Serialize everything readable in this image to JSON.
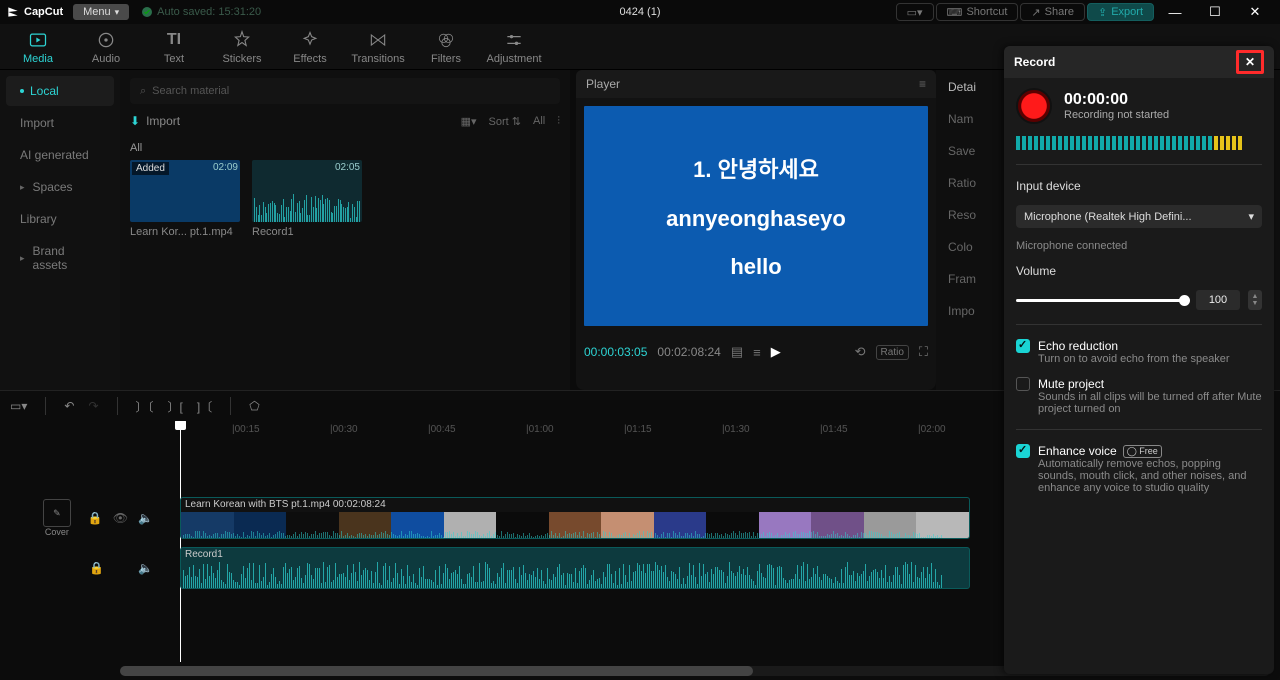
{
  "titlebar": {
    "brand": "CapCut",
    "menu_label": "Menu",
    "autosave": "Auto saved: 15:31:20",
    "project": "0424 (1)",
    "shortcut": "Shortcut",
    "share": "Share",
    "export": "Export"
  },
  "toptabs": [
    {
      "label": "Media",
      "icon": "media"
    },
    {
      "label": "Audio",
      "icon": "audio"
    },
    {
      "label": "Text",
      "icon": "text"
    },
    {
      "label": "Stickers",
      "icon": "stickers"
    },
    {
      "label": "Effects",
      "icon": "effects"
    },
    {
      "label": "Transitions",
      "icon": "transitions"
    },
    {
      "label": "Filters",
      "icon": "filters"
    },
    {
      "label": "Adjustment",
      "icon": "adjust"
    }
  ],
  "sidebar": {
    "items": [
      {
        "label": "Local",
        "active": true,
        "dot": true
      },
      {
        "label": "Import"
      },
      {
        "label": "AI generated"
      },
      {
        "label": "Spaces",
        "chev": true
      },
      {
        "label": "Library"
      },
      {
        "label": "Brand assets",
        "chev": true
      }
    ]
  },
  "media": {
    "search_placeholder": "Search material",
    "import_label": "Import",
    "sort_label": "Sort",
    "all_btn": "All",
    "all_label": "All",
    "clips": [
      {
        "name": "Learn Kor... pt.1.mp4",
        "dur": "02:09",
        "tag": "Added",
        "kind": "video"
      },
      {
        "name": "Record1",
        "dur": "02:05",
        "kind": "audio"
      }
    ]
  },
  "player": {
    "title": "Player",
    "line1": "1. 안녕하세요",
    "line2": "annyeonghaseyo",
    "line3": "hello",
    "cur": "00:00:03:05",
    "tot": "00:02:08:24",
    "ratio": "Ratio"
  },
  "details": {
    "heading": "Detai",
    "rows": [
      "Nam",
      "Save",
      "Ratio",
      "Reso",
      "Colo",
      "Fram",
      "Impo"
    ]
  },
  "timeline": {
    "marks": [
      "|00:15",
      "|00:30",
      "|00:45",
      "|01:00",
      "|01:15",
      "|01:30",
      "|01:45",
      "|02:00"
    ],
    "cover": "Cover",
    "video_clip": "Learn Korean with BTS pt.1.mp4   00:02:08:24",
    "audio_clip": "Record1"
  },
  "record": {
    "title": "Record",
    "time": "00:00:00",
    "status": "Recording not started",
    "input_label": "Input device",
    "input_value": "Microphone (Realtek High Defini...",
    "mic_status": "Microphone connected",
    "volume_label": "Volume",
    "volume_value": "100",
    "echo_label": "Echo reduction",
    "echo_desc": "Turn on to avoid echo from the speaker",
    "mute_label": "Mute project",
    "mute_desc": "Sounds in all clips will be turned off after Mute project turned on",
    "enhance_label": "Enhance voice",
    "enhance_badge": "◯ Free",
    "enhance_desc": "Automatically remove echos, popping sounds, mouth click, and other noises, and enhance any voice to studio quality"
  }
}
